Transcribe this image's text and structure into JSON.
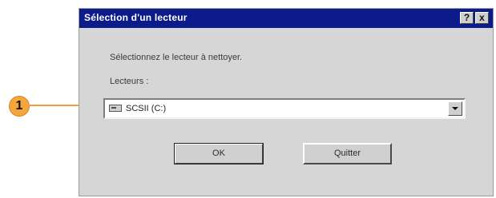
{
  "callout": {
    "number": "1"
  },
  "dialog": {
    "title": "Sélection d'un lecteur",
    "help_button": "?",
    "close_button": "x",
    "prompt": "Sélectionnez le lecteur à nettoyer.",
    "drives_label": "Lecteurs :",
    "drive_combo": {
      "selected": "SCSII (C:)",
      "icon": "hard-drive-icon"
    },
    "ok_button": "OK",
    "quit_button": "Quitter"
  }
}
